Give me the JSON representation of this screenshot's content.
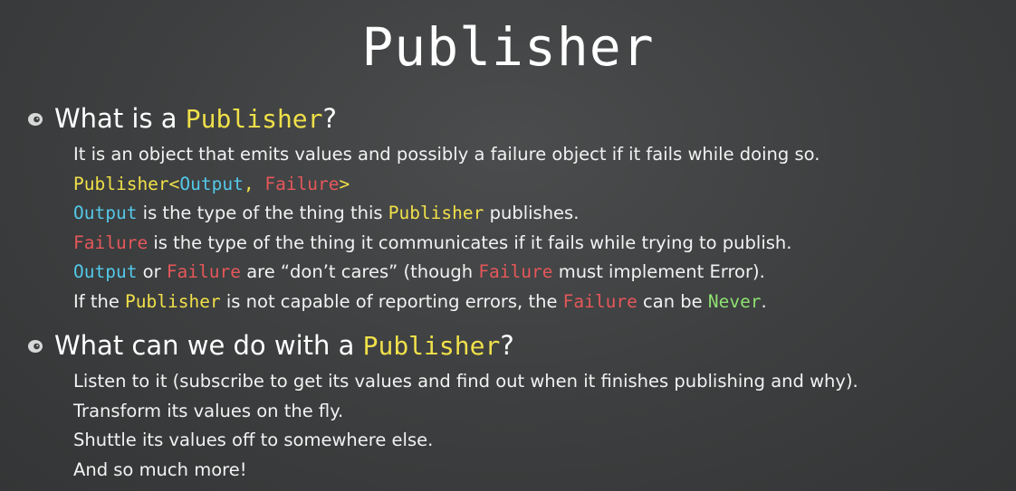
{
  "title": "Publisher",
  "sections": [
    {
      "heading": [
        "What is a ",
        "Publisher",
        "?"
      ],
      "lines": [
        [
          "It is an object that emits values and possibly a failure object if it fails while doing so."
        ],
        [
          "Publisher<",
          "Output",
          ", ",
          "Failure",
          ">"
        ],
        [
          "Output",
          " is the type of the thing this ",
          "Publisher",
          " publishes."
        ],
        [
          "Failure",
          " is the type of the thing it communicates if it fails while trying to publish."
        ],
        [
          "Output",
          " or ",
          "Failure",
          " are “don’t cares” (though ",
          "Failure",
          " must implement Error)."
        ],
        [
          "If the ",
          "Publisher",
          " is not capable of reporting errors, the ",
          "Failure",
          " can be ",
          "Never",
          "."
        ]
      ]
    },
    {
      "heading": [
        "What can we do with a ",
        "Publisher",
        "?"
      ],
      "lines": [
        [
          "Listen to it (subscribe to get its values and find out when it finishes publishing and why)."
        ],
        [
          "Transform its values on the fly."
        ],
        [
          "Shuttle its values off to somewhere else."
        ],
        [
          "And so much more!"
        ]
      ]
    }
  ],
  "colors": {
    "background": "#3c3e3f",
    "publisher": "#f0e04a",
    "output": "#54c8e8",
    "failure": "#e5575a",
    "never": "#8ee070"
  },
  "icons": {
    "bullet": "eye-bullet-icon"
  }
}
